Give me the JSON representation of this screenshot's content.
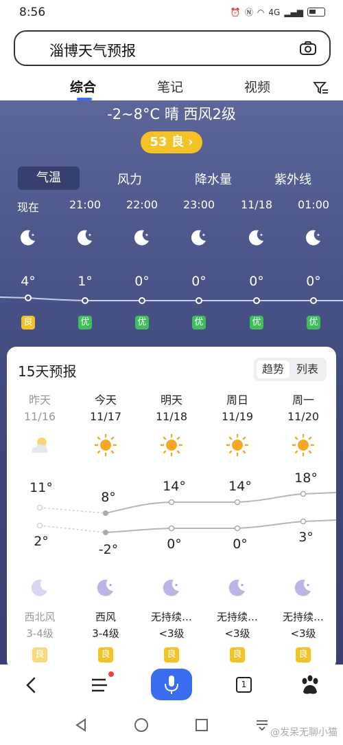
{
  "status_bar": {
    "time": "8:56",
    "network": "4G",
    "battery": ""
  },
  "search": {
    "query": "淄博天气预报"
  },
  "tabs": [
    {
      "label": "综合",
      "active": true
    },
    {
      "label": "笔记",
      "active": false
    },
    {
      "label": "视频",
      "active": false
    }
  ],
  "weather": {
    "summary": "-2~8°C 晴 西风2级",
    "aqi": "53 良 ›",
    "sub_tabs": [
      "气温",
      "风力",
      "降水量",
      "紫外线"
    ],
    "hourly": [
      {
        "time": "现在",
        "temp": "4°",
        "aq": "良"
      },
      {
        "time": "21:00",
        "temp": "1°",
        "aq": "优"
      },
      {
        "time": "22:00",
        "temp": "0°",
        "aq": "优"
      },
      {
        "time": "23:00",
        "temp": "0°",
        "aq": "优"
      },
      {
        "time": "11/18",
        "temp": "0°",
        "aq": "优"
      },
      {
        "time": "01:00",
        "temp": "0°",
        "aq": "优"
      }
    ]
  },
  "forecast": {
    "title": "15天预报",
    "toggle": [
      "趋势",
      "列表"
    ],
    "days": [
      {
        "name": "昨天",
        "date": "11/16",
        "high": "11°",
        "low": "2°",
        "wind": "西北风",
        "wind_level": "3-4级",
        "aq": "良",
        "icon": "partly-cloudy-icon"
      },
      {
        "name": "今天",
        "date": "11/17",
        "high": "8°",
        "low": "-2°",
        "wind": "西风",
        "wind_level": "3-4级",
        "aq": "良",
        "icon": "sun-icon"
      },
      {
        "name": "明天",
        "date": "11/18",
        "high": "14°",
        "low": "0°",
        "wind": "无持续…",
        "wind_level": "<3级",
        "aq": "良",
        "icon": "sun-icon"
      },
      {
        "name": "周日",
        "date": "11/19",
        "high": "14°",
        "low": "0°",
        "wind": "无持续…",
        "wind_level": "<3级",
        "aq": "良",
        "icon": "sun-icon"
      },
      {
        "name": "周一",
        "date": "11/20",
        "high": "18°",
        "low": "3°",
        "wind": "无持续…",
        "wind_level": "<3级",
        "aq": "良",
        "icon": "sun-icon"
      }
    ]
  },
  "bottom_nav": {
    "tab_count": "1"
  },
  "watermark": "@发呆无聊小猫",
  "colors": {
    "accent": "#3a6df0",
    "aq_good": "#3fbf5a",
    "aq_moderate": "#f3c224",
    "hero_bg": "#4b5489"
  }
}
